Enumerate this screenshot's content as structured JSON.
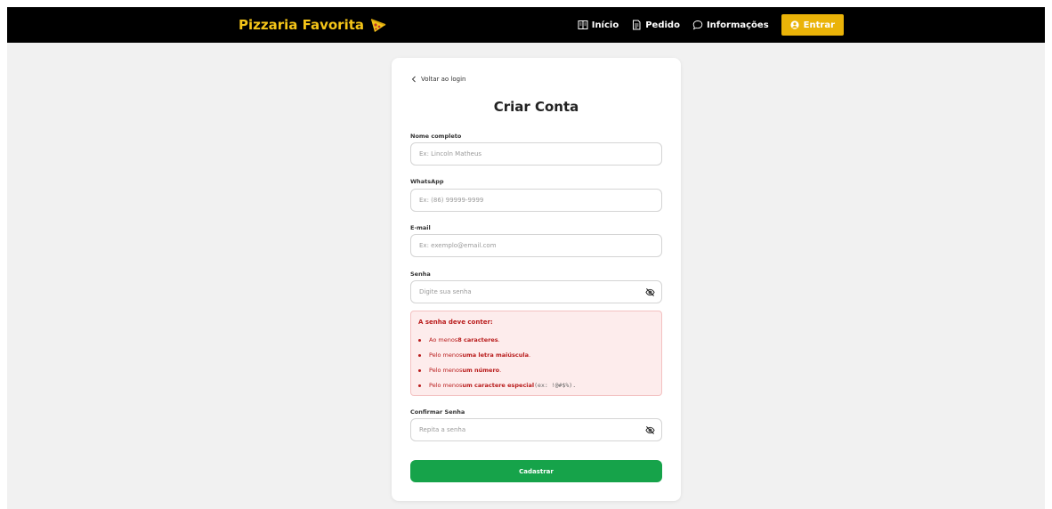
{
  "navbar": {
    "brand": "Pizzaria Favorita",
    "links": [
      {
        "label": "Início",
        "icon": "menu-book-icon"
      },
      {
        "label": "Pedido",
        "icon": "receipt-icon"
      },
      {
        "label": "Informações",
        "icon": "chat-bubble-icon"
      }
    ],
    "login_label": "Entrar",
    "brand_color": "#f5c518",
    "accent_color": "#eab308"
  },
  "card": {
    "back_label": "Voltar ao login",
    "title": "Criar Conta",
    "fields": {
      "name": {
        "label": "Nome completo",
        "placeholder": "Ex: Lincoln Matheus"
      },
      "whatsapp": {
        "label": "WhatsApp",
        "placeholder": "Ex: (86) 99999-9999"
      },
      "email": {
        "label": "E-mail",
        "placeholder": "Ex: exemplo@email.com"
      },
      "password": {
        "label": "Senha",
        "placeholder": "Digite sua senha"
      },
      "confirm": {
        "label": "Confirmar Senha",
        "placeholder": "Repita a senha"
      }
    },
    "password_rules": {
      "title": "A senha deve conter:",
      "rules": [
        {
          "prefix": "Ao menos ",
          "bold": "8 caracteres",
          "suffix": ".",
          "code": ""
        },
        {
          "prefix": "Pelo menos ",
          "bold": "uma letra maiúscula",
          "suffix": ".",
          "code": ""
        },
        {
          "prefix": "Pelo menos ",
          "bold": "um número",
          "suffix": ".",
          "code": ""
        },
        {
          "prefix": "Pelo menos ",
          "bold": "um caractere especial",
          "suffix": ").",
          "code": " (ex: !@#$%"
        }
      ]
    },
    "submit_label": "Cadastrar",
    "submit_color": "#16a34a"
  }
}
